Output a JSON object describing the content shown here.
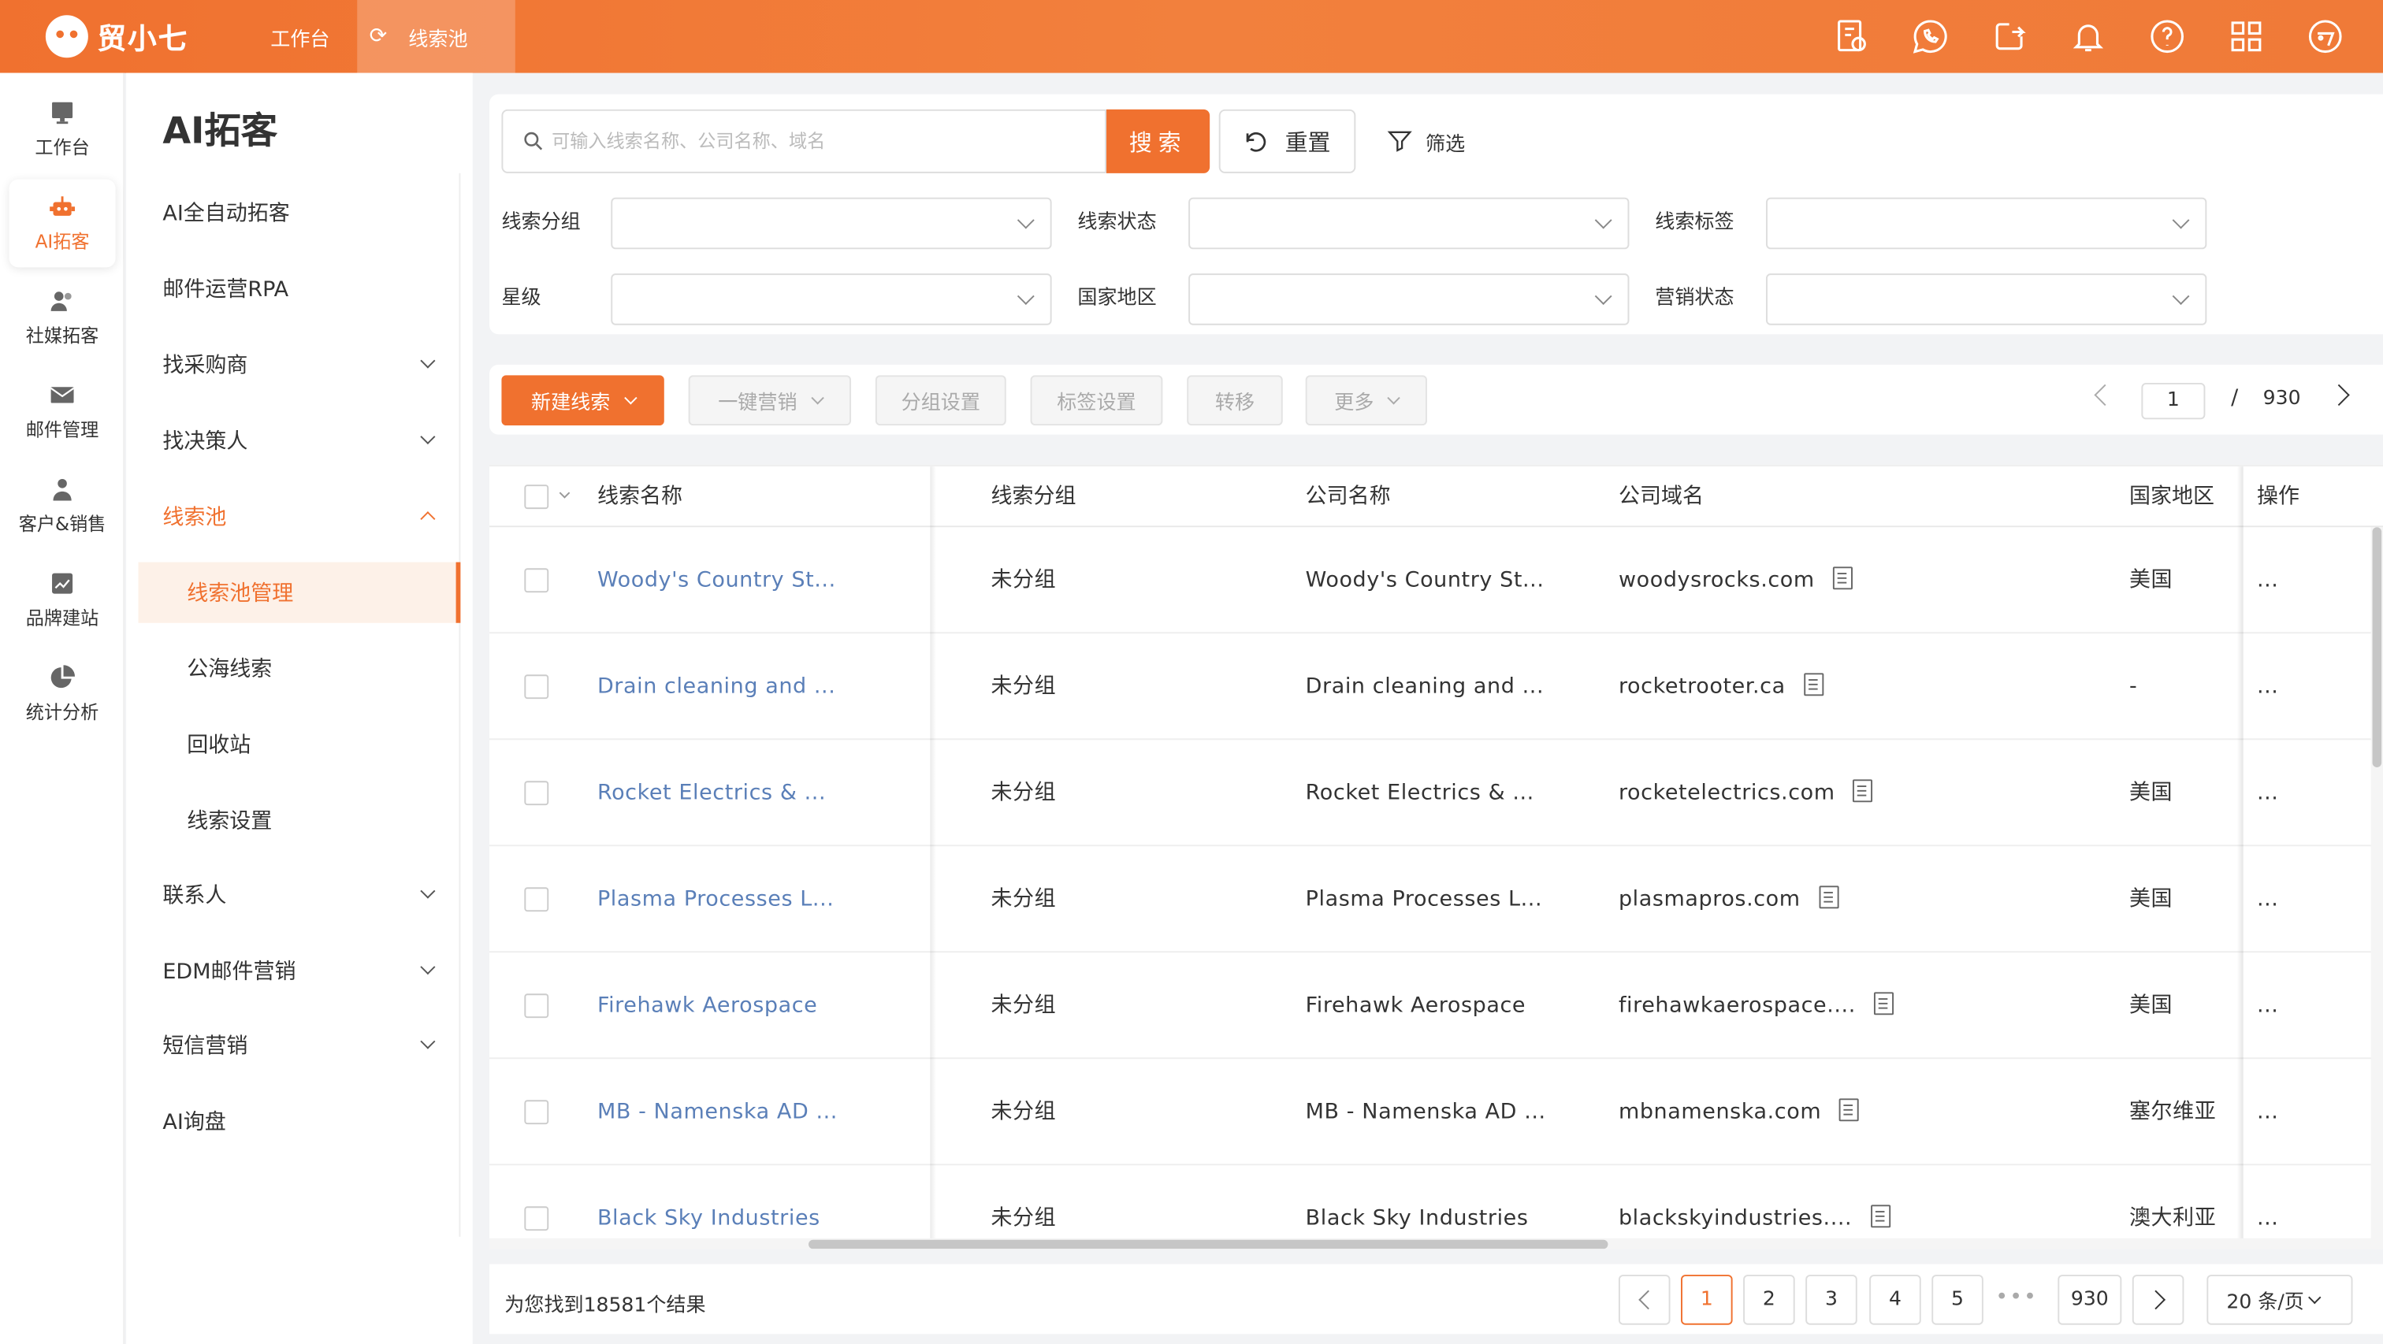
{
  "brand": {
    "name": "贸小七"
  },
  "top_tabs": [
    {
      "label": "工作台"
    },
    {
      "label": "线索池"
    }
  ],
  "rail": [
    {
      "label": "工作台",
      "icon": "monitor-icon"
    },
    {
      "label": "AI拓客",
      "icon": "robot-icon"
    },
    {
      "label": "社媒拓客",
      "icon": "users-icon"
    },
    {
      "label": "邮件管理",
      "icon": "mail-icon"
    },
    {
      "label": "客户&销售",
      "icon": "person-icon"
    },
    {
      "label": "品牌建站",
      "icon": "chart-icon"
    },
    {
      "label": "统计分析",
      "icon": "pie-icon"
    }
  ],
  "menu": {
    "title": "AI拓客",
    "items": [
      {
        "label": "AI全自动拓客"
      },
      {
        "label": "邮件运营RPA"
      },
      {
        "label": "找采购商"
      },
      {
        "label": "找决策人"
      },
      {
        "label": "线索池"
      },
      {
        "label": "线索池管理"
      },
      {
        "label": "公海线索"
      },
      {
        "label": "回收站"
      },
      {
        "label": "线索设置"
      },
      {
        "label": "联系人"
      },
      {
        "label": "EDM邮件营销"
      },
      {
        "label": "短信营销"
      },
      {
        "label": "AI询盘"
      }
    ]
  },
  "search": {
    "placeholder": "可输入线索名称、公司名称、域名",
    "value": "",
    "button": "搜索",
    "reset": "重置",
    "filter": "筛选"
  },
  "filters": [
    {
      "label": "线索分组",
      "value": ""
    },
    {
      "label": "线索状态",
      "value": ""
    },
    {
      "label": "线索标签",
      "value": ""
    },
    {
      "label": "星级",
      "value": ""
    },
    {
      "label": "国家地区",
      "value": ""
    },
    {
      "label": "营销状态",
      "value": ""
    }
  ],
  "toolbar": {
    "new_lead": "新建线索",
    "one_click": "一键营销",
    "group": "分组设置",
    "tag": "标签设置",
    "transfer": "转移",
    "more": "更多"
  },
  "top_pager": {
    "current": "1",
    "sep": "/",
    "total": "930"
  },
  "table": {
    "headers": {
      "name": "线索名称",
      "group": "线索分组",
      "company": "公司名称",
      "domain": "公司域名",
      "country": "国家地区",
      "action": "操作"
    },
    "rows": [
      {
        "name": "Woody's Country St...",
        "group": "未分组",
        "company": "Woody's Country St...",
        "domain": "woodysrocks.com",
        "country": "美国",
        "action": "..."
      },
      {
        "name": "Drain cleaning and ...",
        "group": "未分组",
        "company": "Drain cleaning and ...",
        "domain": "rocketrooter.ca",
        "country": "-",
        "action": "..."
      },
      {
        "name": "Rocket Electrics & ...",
        "group": "未分组",
        "company": "Rocket Electrics & ...",
        "domain": "rocketelectrics.com",
        "country": "美国",
        "action": "..."
      },
      {
        "name": "Plasma Processes L...",
        "group": "未分组",
        "company": "Plasma Processes L...",
        "domain": "plasmapros.com",
        "country": "美国",
        "action": "..."
      },
      {
        "name": "Firehawk Aerospace",
        "group": "未分组",
        "company": "Firehawk Aerospace",
        "domain": "firehawkaerospace....",
        "country": "美国",
        "action": "..."
      },
      {
        "name": "MB - Namenska AD ...",
        "group": "未分组",
        "company": "MB - Namenska AD ...",
        "domain": "mbnamenska.com",
        "country": "塞尔维亚",
        "action": "..."
      },
      {
        "name": "Black Sky Industries",
        "group": "未分组",
        "company": "Black Sky Industries",
        "domain": "blackskyindustries....",
        "country": "澳大利亚",
        "action": "..."
      }
    ]
  },
  "footer": {
    "result": "为您找到18581个结果",
    "pages": [
      "1",
      "2",
      "3",
      "4",
      "5"
    ],
    "dots": "•••",
    "last": "930",
    "page_size": "20 条/页"
  },
  "colors": {
    "accent": "#f0712f",
    "link": "#5a7fb8"
  }
}
